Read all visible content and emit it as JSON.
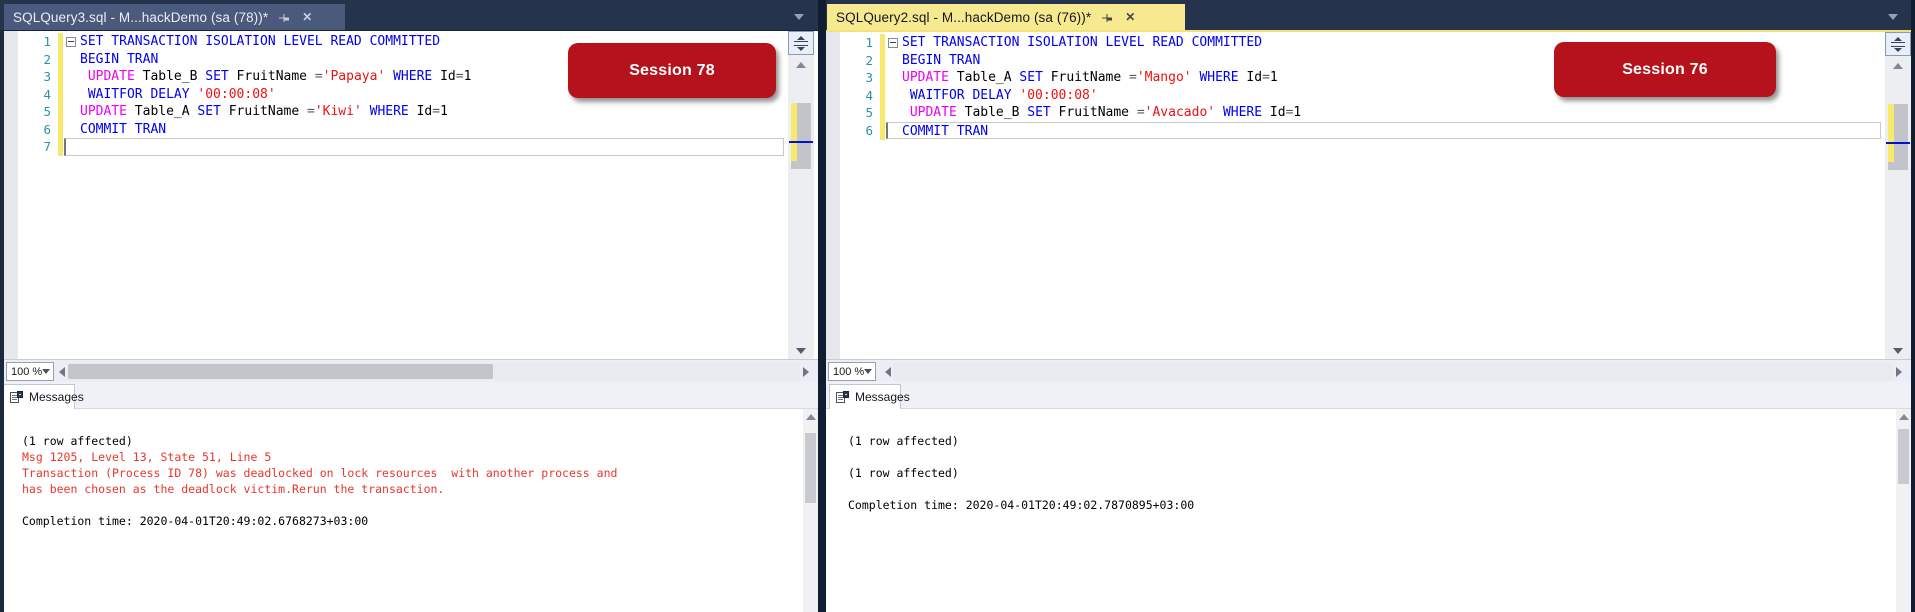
{
  "colors": {
    "badge_red": "#B5121B",
    "error_red": "#E8362B",
    "keyword_blue": "#0000EE",
    "keyword_magenta": "#EE00EE",
    "string_red": "#EE1111",
    "line_number_blue": "#2B91AF",
    "active_tab_yellow": "#F6E98F",
    "inactive_tab_blue": "#4A5A7C",
    "change_bar_yellow": "#F6E96B",
    "tab_strip_dark": "#26334C"
  },
  "panes": [
    {
      "tab_title": "SQLQuery3.sql - M...hackDemo (sa (78))*",
      "session_badge": "Session 78",
      "zoom_level": "100 %",
      "messages_tab_label": "Messages",
      "code_lines": [
        {
          "num": 1,
          "fold": true,
          "tokens": [
            {
              "c": "kw",
              "t": "SET TRANSACTION ISOLATION LEVEL READ COMMITTED"
            }
          ]
        },
        {
          "num": 2,
          "tokens": [
            {
              "c": "kw",
              "t": "BEGIN TRAN"
            }
          ]
        },
        {
          "num": 3,
          "tokens": [
            {
              "c": "pl",
              "t": " "
            },
            {
              "c": "mg",
              "t": "UPDATE"
            },
            {
              "c": "pl",
              "t": " Table_B "
            },
            {
              "c": "kw",
              "t": "SET"
            },
            {
              "c": "pl",
              "t": " FruitName "
            },
            {
              "c": "op",
              "t": "="
            },
            {
              "c": "st",
              "t": "'Papaya'"
            },
            {
              "c": "pl",
              "t": " "
            },
            {
              "c": "kw",
              "t": "WHERE"
            },
            {
              "c": "pl",
              "t": " Id"
            },
            {
              "c": "op",
              "t": "="
            },
            {
              "c": "pl",
              "t": "1"
            }
          ]
        },
        {
          "num": 4,
          "tokens": [
            {
              "c": "pl",
              "t": " "
            },
            {
              "c": "kw",
              "t": "WAITFOR DELAY"
            },
            {
              "c": "pl",
              "t": " "
            },
            {
              "c": "st",
              "t": "'00:00:08'"
            }
          ]
        },
        {
          "num": 5,
          "tokens": [
            {
              "c": "mg",
              "t": "UPDATE"
            },
            {
              "c": "pl",
              "t": " Table_A "
            },
            {
              "c": "kw",
              "t": "SET"
            },
            {
              "c": "pl",
              "t": " FruitName "
            },
            {
              "c": "op",
              "t": "="
            },
            {
              "c": "st",
              "t": "'Kiwi'"
            },
            {
              "c": "pl",
              "t": " "
            },
            {
              "c": "kw",
              "t": "WHERE"
            },
            {
              "c": "pl",
              "t": " Id"
            },
            {
              "c": "op",
              "t": "="
            },
            {
              "c": "pl",
              "t": "1"
            }
          ]
        },
        {
          "num": 6,
          "tokens": [
            {
              "c": "kw",
              "t": "COMMIT TRAN"
            }
          ]
        },
        {
          "num": 7,
          "current": true,
          "tokens": []
        }
      ],
      "messages": [
        {
          "c": "k",
          "t": "(1 row affected)"
        },
        {
          "c": "e",
          "t": "Msg 1205, Level 13, State 51, Line 5"
        },
        {
          "c": "e",
          "t": "Transaction (Process ID 78) was deadlocked on lock resources  with another process and"
        },
        {
          "c": "e",
          "t": "has been chosen as the deadlock victim.Rerun the transaction."
        },
        {
          "c": "k",
          "t": ""
        },
        {
          "c": "k",
          "t": "Completion time: 2020-04-01T20:49:02.6768273+03:00"
        }
      ]
    },
    {
      "tab_title": "SQLQuery2.sql - M...hackDemo (sa (76))*",
      "session_badge": "Session 76",
      "zoom_level": "100 %",
      "messages_tab_label": "Messages",
      "code_lines": [
        {
          "num": 1,
          "fold": true,
          "tokens": [
            {
              "c": "kw",
              "t": "SET TRANSACTION ISOLATION LEVEL READ COMMITTED"
            }
          ]
        },
        {
          "num": 2,
          "tokens": [
            {
              "c": "kw",
              "t": "BEGIN TRAN"
            }
          ]
        },
        {
          "num": 3,
          "tokens": [
            {
              "c": "mg",
              "t": "UPDATE"
            },
            {
              "c": "pl",
              "t": " Table_A "
            },
            {
              "c": "kw",
              "t": "SET"
            },
            {
              "c": "pl",
              "t": " FruitName "
            },
            {
              "c": "op",
              "t": "="
            },
            {
              "c": "st",
              "t": "'Mango'"
            },
            {
              "c": "pl",
              "t": " "
            },
            {
              "c": "kw",
              "t": "WHERE"
            },
            {
              "c": "pl",
              "t": " Id"
            },
            {
              "c": "op",
              "t": "="
            },
            {
              "c": "pl",
              "t": "1"
            }
          ]
        },
        {
          "num": 4,
          "tokens": [
            {
              "c": "pl",
              "t": " "
            },
            {
              "c": "kw",
              "t": "WAITFOR DELAY"
            },
            {
              "c": "pl",
              "t": " "
            },
            {
              "c": "st",
              "t": "'00:00:08'"
            }
          ]
        },
        {
          "num": 5,
          "tokens": [
            {
              "c": "pl",
              "t": " "
            },
            {
              "c": "mg",
              "t": "UPDATE"
            },
            {
              "c": "pl",
              "t": " Table_B "
            },
            {
              "c": "kw",
              "t": "SET"
            },
            {
              "c": "pl",
              "t": " FruitName "
            },
            {
              "c": "op",
              "t": "="
            },
            {
              "c": "st",
              "t": "'Avacado'"
            },
            {
              "c": "pl",
              "t": " "
            },
            {
              "c": "kw",
              "t": "WHERE"
            },
            {
              "c": "pl",
              "t": " Id"
            },
            {
              "c": "op",
              "t": "="
            },
            {
              "c": "pl",
              "t": "1"
            }
          ]
        },
        {
          "num": 6,
          "current": true,
          "tokens": [
            {
              "c": "kw",
              "t": "COMMIT TRAN"
            }
          ]
        }
      ],
      "messages": [
        {
          "c": "k",
          "t": "(1 row affected)"
        },
        {
          "c": "k",
          "t": ""
        },
        {
          "c": "k",
          "t": "(1 row affected)"
        },
        {
          "c": "k",
          "t": ""
        },
        {
          "c": "k",
          "t": "Completion time: 2020-04-01T20:49:02.7870895+03:00"
        }
      ]
    }
  ]
}
